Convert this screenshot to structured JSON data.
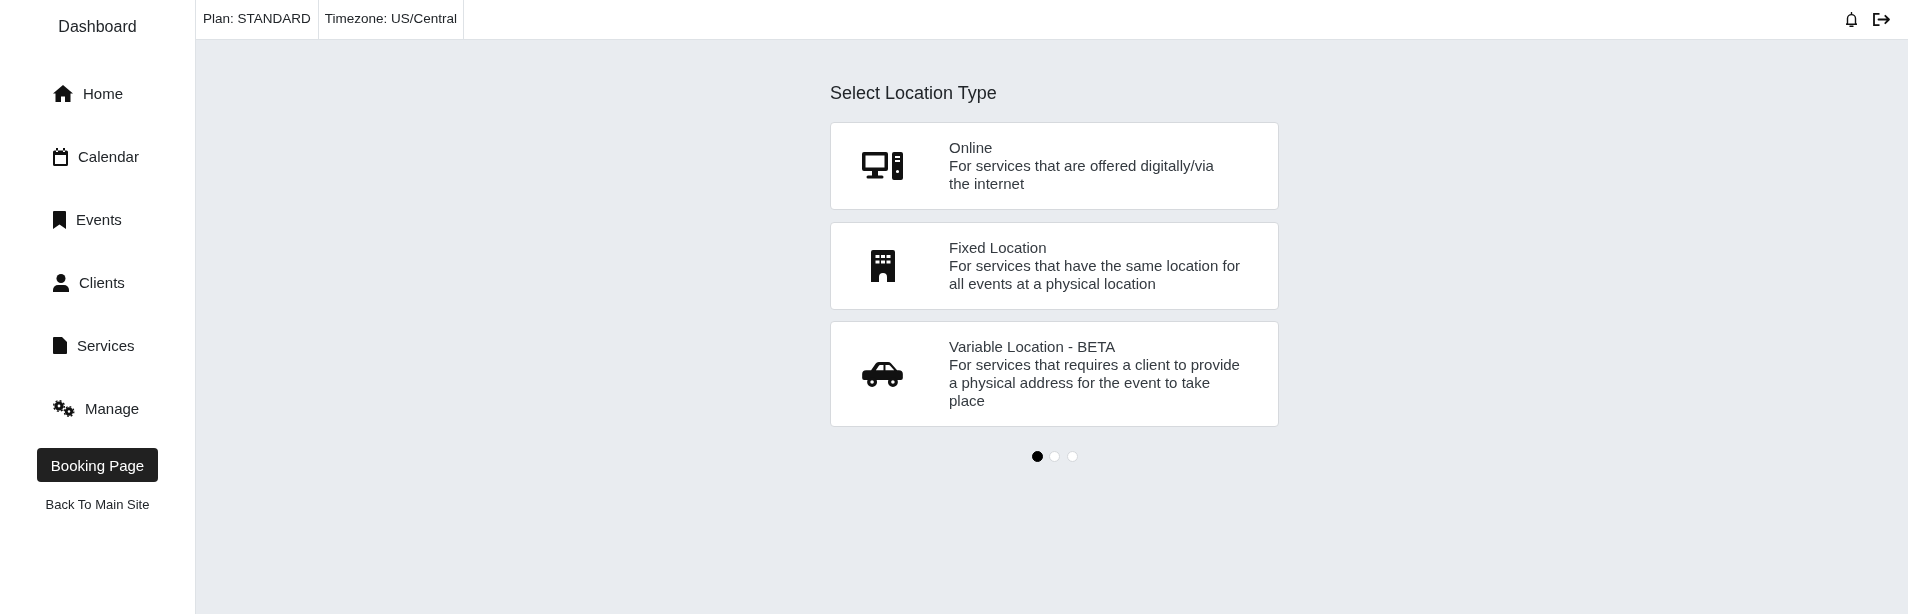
{
  "sidebar": {
    "title": "Dashboard",
    "items": [
      {
        "label": "Home"
      },
      {
        "label": "Calendar"
      },
      {
        "label": "Events"
      },
      {
        "label": "Clients"
      },
      {
        "label": "Services"
      },
      {
        "label": "Manage"
      }
    ],
    "booking_button": "Booking Page",
    "back_link": "Back To Main Site"
  },
  "top_bar": {
    "plan": "Plan: STANDARD",
    "timezone": "Timezone: US/Central"
  },
  "location_picker": {
    "heading": "Select Location Type",
    "options": [
      {
        "title": "Online",
        "description_lines": [
          "For services that are offered digitally/via",
          "the internet"
        ]
      },
      {
        "title": "Fixed Location",
        "description_lines": [
          "For services that have the same location for",
          "all events at a physical location"
        ]
      },
      {
        "title": "Variable Location - BETA",
        "description_lines": [
          "For services that requires a client to provide",
          "a physical address for the event to take",
          "place"
        ]
      }
    ],
    "pages": [
      {
        "selected": true
      },
      {
        "selected": false
      },
      {
        "selected": false
      }
    ]
  }
}
